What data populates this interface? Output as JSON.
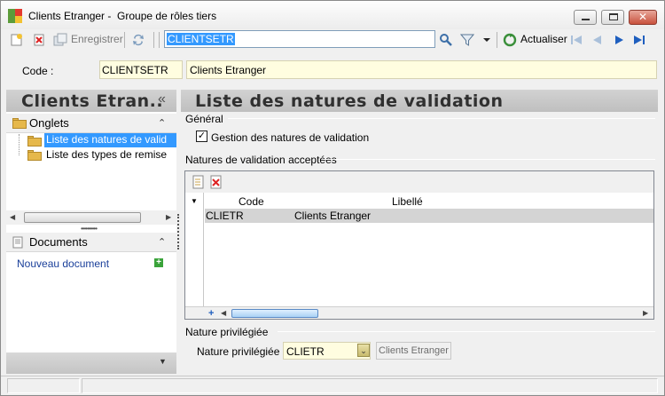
{
  "window": {
    "title": "Clients Etranger -  Groupe de rôles tiers"
  },
  "toolbar": {
    "new_icon": "new-doc-icon",
    "delete_icon": "delete-icon",
    "save_label": "Enregistrer",
    "refresh_icon": "refresh-icon",
    "search_value": "CLIENTSETR",
    "actualiser_label": "Actualiser"
  },
  "record": {
    "code_label": "Code :",
    "code_value": "CLIENTSETR",
    "libelle_value": "Clients Etranger"
  },
  "left_panel": {
    "title": "Clients Etran..",
    "onglets_label": "Onglets",
    "tree_items": [
      "Liste des natures de valid",
      "Liste des types de remise"
    ],
    "documents_label": "Documents",
    "new_document_link": "Nouveau document"
  },
  "main": {
    "title": "Liste des natures de validation",
    "general_group": "Général",
    "checkbox_label": "Gestion des natures de validation",
    "checkbox_checked": true,
    "accepted_group": "Natures de validation acceptées",
    "grid": {
      "columns": [
        "Code",
        "Libellé"
      ],
      "rows": [
        {
          "code": "CLIETR",
          "libelle": "Clients Etranger"
        }
      ]
    },
    "privileged_group": "Nature privilégiée",
    "privileged_label": "Nature privilégiée :",
    "privileged_code": "CLIETR",
    "privileged_libelle": "Clients Etranger"
  },
  "colors": {
    "selection": "#3399ff",
    "field_bg": "#fffde0",
    "panel_header": "#c8c8c8",
    "nav_arrow": "#1f5fbf"
  }
}
